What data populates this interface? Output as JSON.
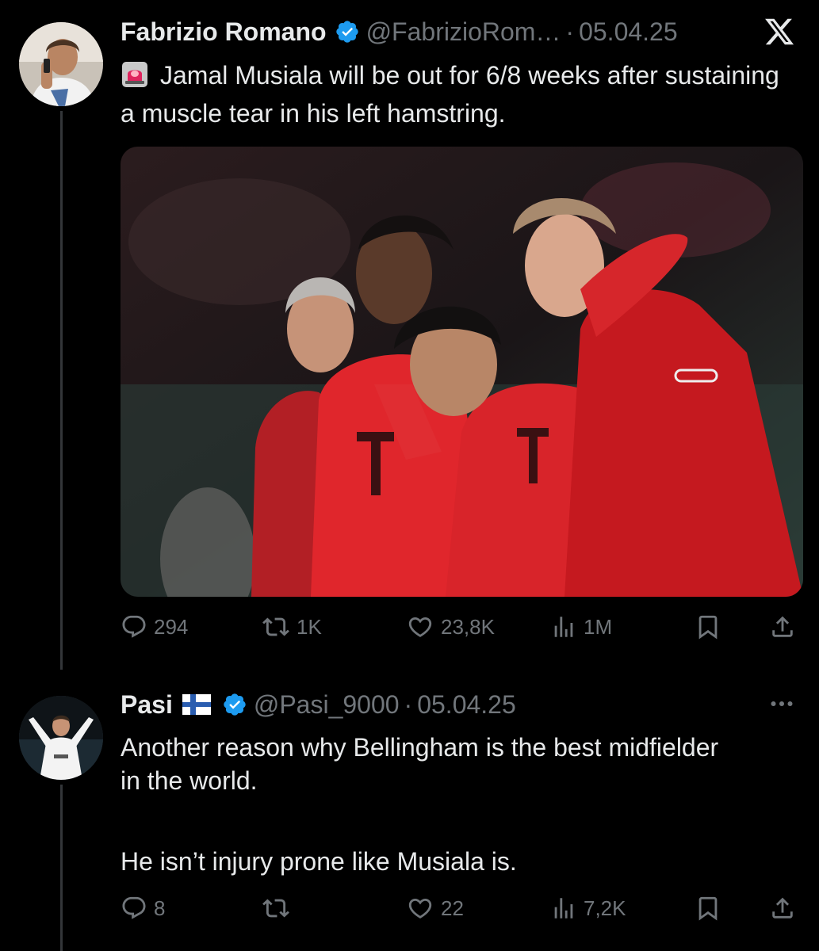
{
  "tweet1": {
    "author_name": "Fabrizio Romano",
    "handle": "@FabrizioRom…",
    "separator": "·",
    "date": "05.04.25",
    "text": "Jamal Musiala will be out for 6/8 weeks after sustaining a muscle tear in his left hamstring.",
    "stats": {
      "replies": "294",
      "reposts": "1K",
      "likes": "23,8K",
      "views": "1M"
    }
  },
  "tweet2": {
    "author_name": "Pasi",
    "handle": "@Pasi_9000",
    "separator": "·",
    "date": "05.04.25",
    "text_line1": "Another reason why Bellingham is the best midfielder in the world.",
    "text_line2": "He isn’t injury prone like Musiala is.",
    "stats": {
      "replies": "8",
      "reposts": "",
      "likes": "22",
      "views": "7,2K"
    }
  },
  "colors": {
    "background": "#000000",
    "text": "#e7e9ea",
    "muted": "#71767b",
    "verified": "#1d9bf0",
    "thread_line": "#333639"
  },
  "icons": [
    "verified-badge-icon",
    "x-logo-icon",
    "siren-icon",
    "finland-flag-icon",
    "more-icon",
    "reply-icon",
    "repost-icon",
    "like-icon",
    "views-icon",
    "bookmark-icon",
    "share-icon"
  ]
}
